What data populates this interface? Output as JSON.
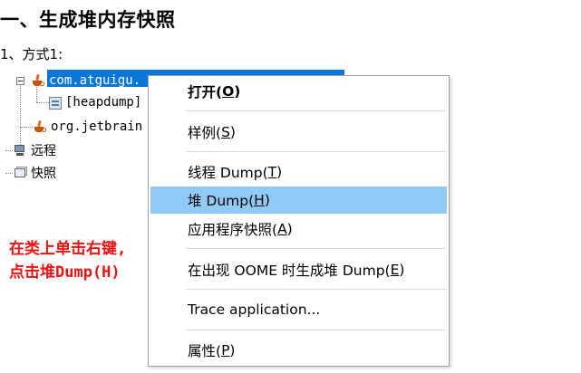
{
  "doc": {
    "heading": "一、生成堆内存快照",
    "subheading": "1、方式1:"
  },
  "tree": {
    "items": [
      {
        "label": "com.atguigu.",
        "selected": true,
        "icon": "java-app-icon"
      },
      {
        "label": "[heapdump]",
        "icon": "heap-dump-icon"
      },
      {
        "label": "org.jetbrain",
        "icon": "java-app-icon"
      },
      {
        "label": "远程",
        "icon": "remote-host-icon"
      },
      {
        "label": "快照",
        "icon": "snapshot-icon"
      }
    ]
  },
  "annotation": {
    "line1": "在类上单击右键,",
    "line2": "点击堆Dump(H)",
    "color": "#ee1111"
  },
  "menu": {
    "items": [
      {
        "pre": "打开(",
        "key": "O",
        "post": ")",
        "bold": true
      },
      {
        "pre": "样例(",
        "key": "S",
        "post": ")"
      },
      {
        "pre": "线程 Dump(",
        "key": "T",
        "post": ")"
      },
      {
        "pre": "堆 Dump(",
        "key": "H",
        "post": ")",
        "highlighted": true
      },
      {
        "pre": "应用程序快照(",
        "key": "A",
        "post": ")"
      },
      {
        "pre": "在出现 OOME 时生成堆 Dump(",
        "key": "E",
        "post": ")"
      },
      {
        "pre": "Trace application...",
        "key": "",
        "post": ""
      },
      {
        "pre": "属性(",
        "key": "P",
        "post": ")"
      }
    ],
    "highlight_color": "#91c9f7"
  },
  "colors": {
    "selection": "#0a76d8"
  }
}
